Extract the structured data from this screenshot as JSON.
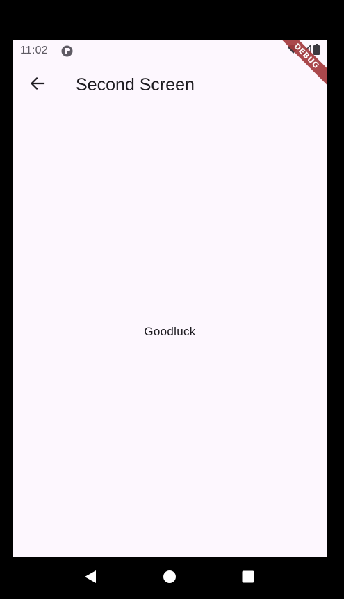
{
  "status_bar": {
    "time": "11:02",
    "app_icon": "play-store-icon",
    "icons": [
      "wifi-icon",
      "signal-icon",
      "battery-icon"
    ]
  },
  "debug_banner": {
    "label": "DEBUG",
    "color": "#a33a3d"
  },
  "app_bar": {
    "back_icon": "arrow-back-icon",
    "title": "Second Screen"
  },
  "body": {
    "text": "Goodluck"
  },
  "nav_bar": {
    "buttons": [
      "back-triangle-icon",
      "home-circle-icon",
      "recents-square-icon"
    ]
  },
  "colors": {
    "screen_background": "#fdf7fe",
    "frame": "#000000",
    "text_primary": "#1d1b20",
    "status_text": "#5f5b64"
  }
}
